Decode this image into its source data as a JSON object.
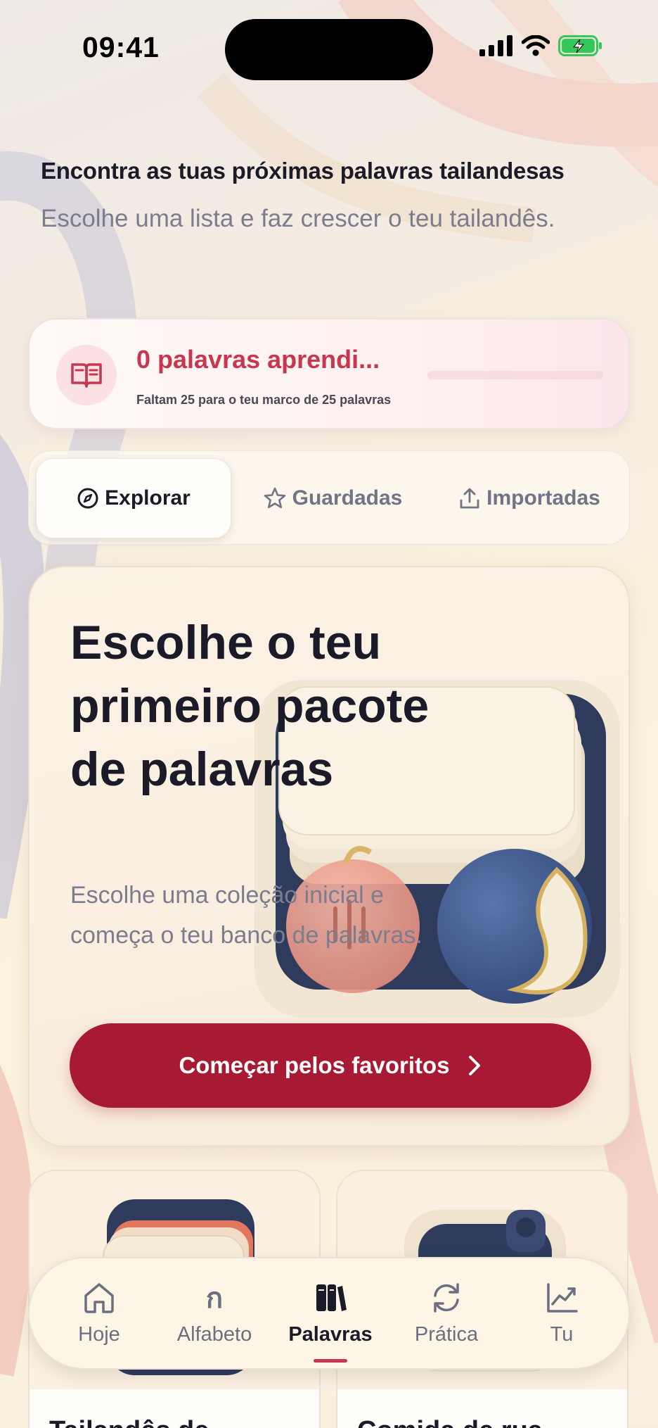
{
  "status_bar": {
    "time": "09:41"
  },
  "header": {
    "title": "Encontra as tuas próximas palavras tailandesas",
    "subtitle": "Escolhe uma lista e faz crescer o teu tailandês."
  },
  "progress": {
    "title": "0 palavras aprendi...",
    "subtitle": "Faltam 25 para o teu marco de 25 palavras",
    "fraction": 0,
    "icon": "open-book-icon"
  },
  "tabs": [
    {
      "label": "Explorar",
      "icon": "compass-icon",
      "active": true
    },
    {
      "label": "Guardadas",
      "icon": "star-icon",
      "active": false
    },
    {
      "label": "Importadas",
      "icon": "upload-icon",
      "active": false
    }
  ],
  "hero": {
    "title": "Escolhe o teu primeiro pacote de palavras",
    "subtitle": "Escolhe uma coleção inicial e começa o teu banco de palavras.",
    "button_label": "Começar pelos favoritos"
  },
  "cards": [
    {
      "label": "Tailandês de"
    },
    {
      "label": "Comida de rua"
    }
  ],
  "bottom_nav": [
    {
      "label": "Hoje",
      "icon": "home-icon",
      "active": false
    },
    {
      "label": "Alfabeto",
      "icon": "thai-letter-icon",
      "glyph": "ก",
      "active": false
    },
    {
      "label": "Palavras",
      "icon": "books-icon",
      "active": true
    },
    {
      "label": "Prática",
      "icon": "refresh-icon",
      "active": false
    },
    {
      "label": "Tu",
      "icon": "chart-icon",
      "active": false
    }
  ],
  "colors": {
    "accent": "#a81a33",
    "accent_text": "#c8374f"
  }
}
